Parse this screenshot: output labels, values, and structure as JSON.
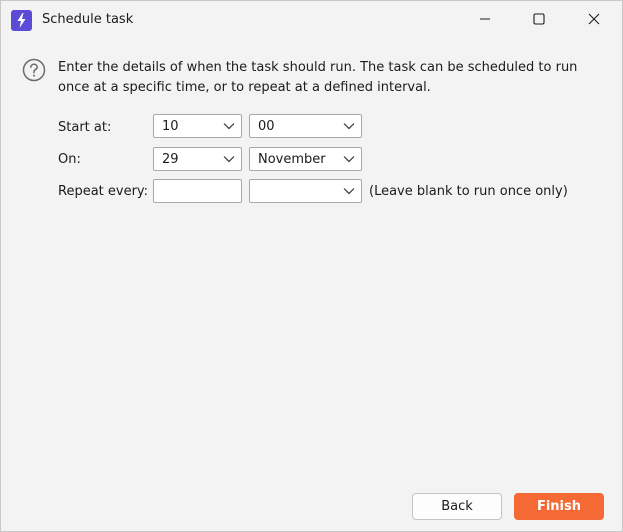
{
  "window": {
    "title": "Schedule task",
    "accent_color": "#5b4bd6"
  },
  "description": "Enter the details of when the task should run. The task can be scheduled to run once at a specific time, or to repeat at a defined interval.",
  "form": {
    "start_at": {
      "label": "Start at:",
      "hour": "10",
      "minute": "00"
    },
    "on": {
      "label": "On:",
      "day": "29",
      "month": "November"
    },
    "repeat": {
      "label": "Repeat every:",
      "interval": "",
      "unit": "",
      "hint": "(Leave blank to run once only)"
    }
  },
  "buttons": {
    "back": "Back",
    "finish": "Finish",
    "finish_color": "#f56a34"
  },
  "icons": [
    "app-icon",
    "help-icon",
    "chevron-down-icon",
    "minimize-icon",
    "maximize-icon",
    "close-icon"
  ]
}
